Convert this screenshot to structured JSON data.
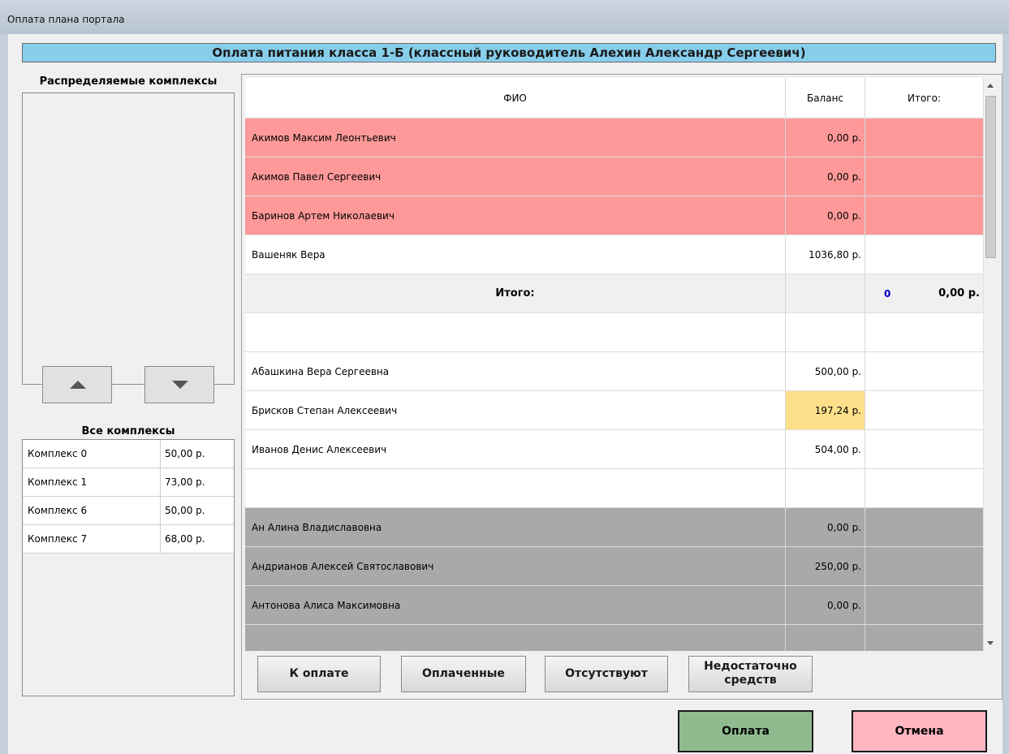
{
  "window": {
    "title": "Оплата плана портала"
  },
  "header": {
    "title": "Оплата питания класса 1-Б (классный руководитель Алехин Александр Сергеевич)"
  },
  "left": {
    "distributed_label": "Распределяемые комплексы",
    "all_label": "Все комплексы",
    "complexes": [
      {
        "name": "Комплекс 0",
        "price": "50,00 р."
      },
      {
        "name": "Комплекс 1",
        "price": "73,00 р."
      },
      {
        "name": "Комплекс 6",
        "price": "50,00 р."
      },
      {
        "name": "Комплекс 7",
        "price": "68,00 р."
      }
    ]
  },
  "grid": {
    "columns": [
      "ФИО",
      "Баланс",
      "Итого:"
    ],
    "group_topay": [
      {
        "name": "Акимов Максим Леонтьевич",
        "balance": "0,00 р."
      },
      {
        "name": "Акимов Павел Сергеевич",
        "balance": "0,00 р."
      },
      {
        "name": "Баринов Артем Николаевич",
        "balance": "0,00 р."
      },
      {
        "name": "Вашеняк Вера",
        "balance": "1036,80 р."
      }
    ],
    "total": {
      "label": "Итого:",
      "count": "0",
      "sum": "0,00 р."
    },
    "group_paid": [
      {
        "name": "Абашкина Вера Сергеевна",
        "balance": "500,00 р."
      },
      {
        "name": "Брисков Степан Алексеевич",
        "balance": "197,24 р."
      },
      {
        "name": "Иванов Денис Алексеевич",
        "balance": "504,00 р."
      }
    ],
    "group_absent": [
      {
        "name": "Ан Алина Владиславовна",
        "balance": "0,00 р."
      },
      {
        "name": "Андрианов Алексей Святославович",
        "balance": "250,00 р."
      },
      {
        "name": "Антонова Алиса Максимовна",
        "balance": "0,00 р."
      }
    ]
  },
  "filters": {
    "topay": "К оплате",
    "paid": "Оплаченные",
    "absent": "Отсутствуют",
    "insufficient_1": "Недостаточно",
    "insufficient_2": "средств"
  },
  "actions": {
    "pay": "Оплата",
    "cancel": "Отмена"
  },
  "colors": {
    "header": "#87ceeb",
    "debtor": "#ff9999",
    "absent": "#a9a9a9",
    "highlight": "#ffe08a",
    "pay": "#8fbc8f",
    "cancel": "#ffb6c1"
  }
}
